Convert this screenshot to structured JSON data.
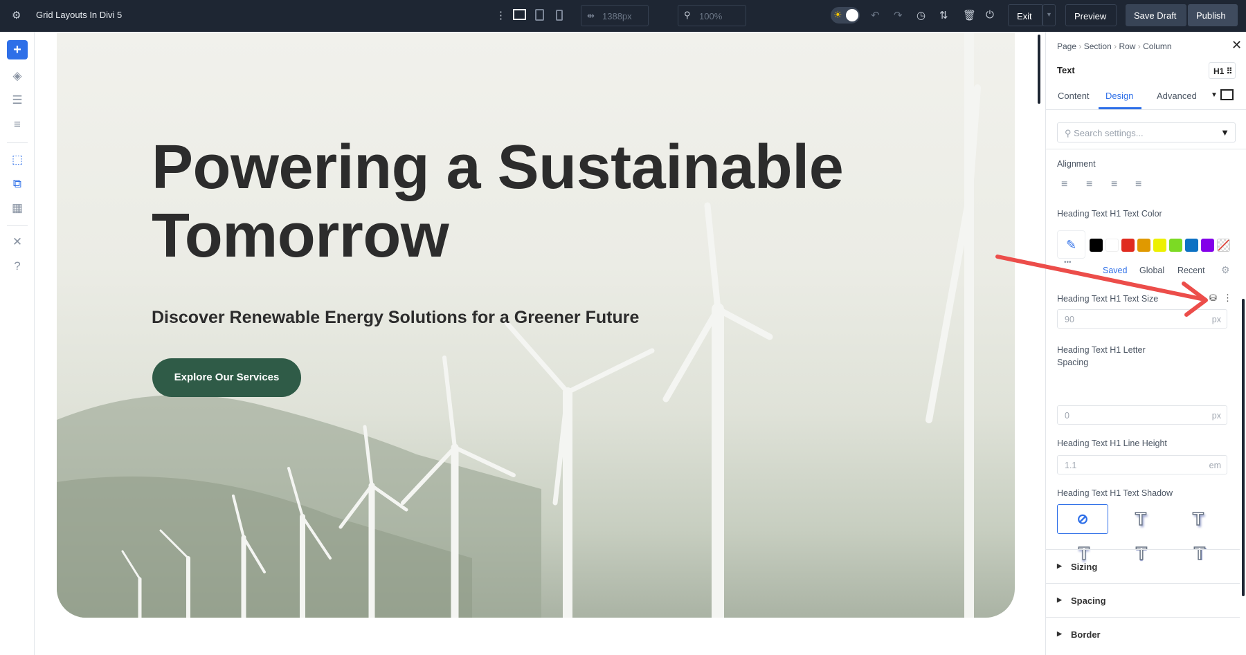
{
  "topbar": {
    "title": "Grid Layouts In Divi 5",
    "width_value": "1388px",
    "zoom_value": "100%",
    "exit": "Exit",
    "preview": "Preview",
    "save_draft": "Save Draft",
    "publish": "Publish"
  },
  "hero": {
    "heading": "Powering a Sustainable Tomorrow",
    "subheading": "Discover Renewable Energy Solutions for a Greener Future",
    "button": "Explore Our Services",
    "button_color": "#2f5b47"
  },
  "panel": {
    "breadcrumb": [
      "Page",
      "Section",
      "Row",
      "Column"
    ],
    "module": "Text",
    "heading_level": "H1",
    "tabs": [
      "Content",
      "Design",
      "Advanced"
    ],
    "active_tab": "Design",
    "search_placeholder": "Search settings...",
    "alignment_label": "Alignment",
    "color_label": "Heading Text H1 Text Color",
    "swatches": [
      "#000000",
      "#ffffff",
      "#e02b20",
      "#e09900",
      "#edf000",
      "#7cda24",
      "#0c71c3",
      "#8300e9"
    ],
    "color_tabs": [
      "Saved",
      "Global",
      "Recent"
    ],
    "size_label": "Heading Text H1 Text Size",
    "size_value": "90",
    "size_unit": "px",
    "spacing_label": "Heading Text H1 Letter Spacing",
    "spacing_value": "0",
    "spacing_unit": "px",
    "lh_label": "Heading Text H1 Line Height",
    "lh_value": "1.1",
    "lh_unit": "em",
    "shadow_label": "Heading Text H1 Text Shadow",
    "sections": [
      "Sizing",
      "Spacing",
      "Border"
    ]
  },
  "accent": "#2e6fe8"
}
